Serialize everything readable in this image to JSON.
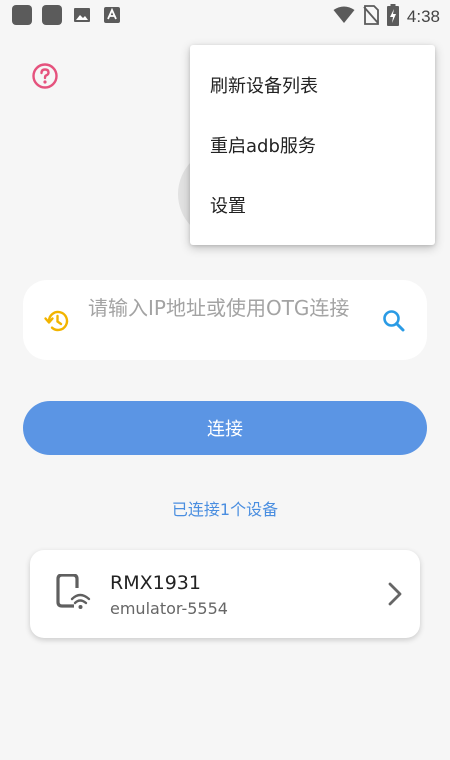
{
  "status_bar": {
    "time": "4:38",
    "icons": [
      "app-square-icon",
      "app-square-icon",
      "image-icon",
      "font-icon",
      "wifi-icon",
      "no-sim-icon",
      "battery-charging-icon"
    ]
  },
  "help": {
    "icon": "help-icon",
    "color": "#e5527d"
  },
  "menu": {
    "items": [
      {
        "label": "刷新设备列表"
      },
      {
        "label": "重启adb服务"
      },
      {
        "label": "设置"
      }
    ]
  },
  "search": {
    "placeholder": "请输入IP地址或使用OTG连接",
    "history_icon": "history-icon",
    "search_icon": "search-icon",
    "accent_history": "#f2b400",
    "accent_search": "#2a9be5"
  },
  "connect": {
    "label": "连接",
    "color": "#5b95e4"
  },
  "connected_info": "已连接1个设备",
  "devices": [
    {
      "name": "RMX1931",
      "serial": "emulator-5554",
      "icon": "phone-wifi-icon"
    }
  ]
}
